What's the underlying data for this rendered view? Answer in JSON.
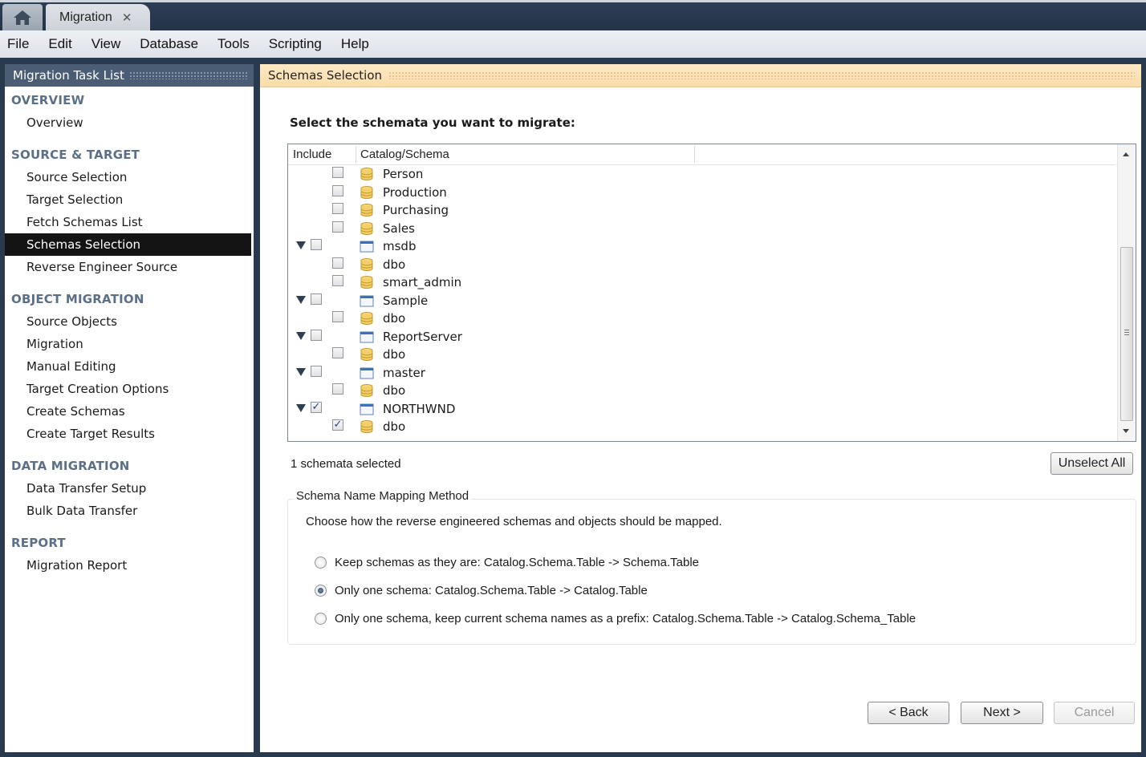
{
  "window": {
    "tab_title": "Migration",
    "tab_close": "✕"
  },
  "menubar": [
    "File",
    "Edit",
    "View",
    "Database",
    "Tools",
    "Scripting",
    "Help"
  ],
  "sidebar": {
    "title": "Migration Task List",
    "sections": [
      {
        "label": "OVERVIEW",
        "items": [
          "Overview"
        ]
      },
      {
        "label": "SOURCE & TARGET",
        "items": [
          "Source Selection",
          "Target Selection",
          "Fetch Schemas List",
          "Schemas Selection",
          "Reverse Engineer Source"
        ]
      },
      {
        "label": "OBJECT MIGRATION",
        "items": [
          "Source Objects",
          "Migration",
          "Manual Editing",
          "Target Creation Options",
          "Create Schemas",
          "Create Target Results"
        ]
      },
      {
        "label": "DATA MIGRATION",
        "items": [
          "Data Transfer Setup",
          "Bulk Data Transfer"
        ]
      },
      {
        "label": "REPORT",
        "items": [
          "Migration Report"
        ]
      }
    ],
    "active_item": "Schemas Selection"
  },
  "main": {
    "header": "Schemas Selection",
    "instruction": "Select the schemata you want to migrate:",
    "tree": {
      "columns": [
        "Include",
        "Catalog/Schema"
      ],
      "rows": [
        {
          "label": "Person",
          "type": "schema",
          "level": 1,
          "checked": false
        },
        {
          "label": "Production",
          "type": "schema",
          "level": 1,
          "checked": false
        },
        {
          "label": "Purchasing",
          "type": "schema",
          "level": 1,
          "checked": false
        },
        {
          "label": "Sales",
          "type": "schema",
          "level": 1,
          "checked": false
        },
        {
          "label": "msdb",
          "type": "catalog",
          "level": 0,
          "checked": false,
          "expanded": true
        },
        {
          "label": "dbo",
          "type": "schema",
          "level": 1,
          "checked": false
        },
        {
          "label": "smart_admin",
          "type": "schema",
          "level": 1,
          "checked": false
        },
        {
          "label": "Sample",
          "type": "catalog",
          "level": 0,
          "checked": false,
          "expanded": true
        },
        {
          "label": "dbo",
          "type": "schema",
          "level": 1,
          "checked": false
        },
        {
          "label": "ReportServer",
          "type": "catalog",
          "level": 0,
          "checked": false,
          "expanded": true
        },
        {
          "label": "dbo",
          "type": "schema",
          "level": 1,
          "checked": false
        },
        {
          "label": "master",
          "type": "catalog",
          "level": 0,
          "checked": false,
          "expanded": true
        },
        {
          "label": "dbo",
          "type": "schema",
          "level": 1,
          "checked": false
        },
        {
          "label": "NORTHWND",
          "type": "catalog",
          "level": 0,
          "checked": true,
          "expanded": true
        },
        {
          "label": "dbo",
          "type": "schema",
          "level": 1,
          "checked": true
        }
      ]
    },
    "status": "1 schemata selected",
    "unselect_all": "Unselect All",
    "mapping": {
      "legend": "Schema Name Mapping Method",
      "description": "Choose how the reverse engineered schemas and objects should be mapped.",
      "options": [
        {
          "label": "Keep schemas as they are: Catalog.Schema.Table -> Schema.Table",
          "selected": false
        },
        {
          "label": "Only one schema: Catalog.Schema.Table -> Catalog.Table",
          "selected": true
        },
        {
          "label": "Only one schema, keep current schema names as a prefix: Catalog.Schema.Table -> Catalog.Schema_Table",
          "selected": false
        }
      ]
    },
    "buttons": {
      "back": "< Back",
      "next": "Next >",
      "cancel": "Cancel"
    }
  }
}
